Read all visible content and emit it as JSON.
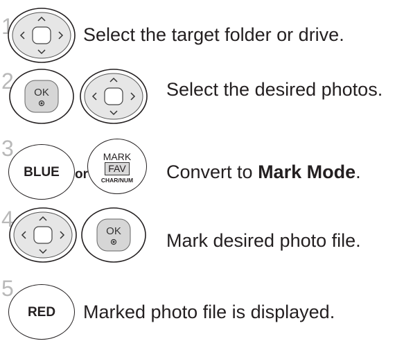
{
  "steps": [
    {
      "number": "1",
      "text": "Select the target folder or drive."
    },
    {
      "number": "2",
      "text": "Select the desired photos."
    },
    {
      "number": "3",
      "text_plain": "Convert to ",
      "text_bold": "Mark Mode",
      "text_end": "."
    },
    {
      "number": "4",
      "text": "Mark desired photo file."
    },
    {
      "number": "5",
      "text": "Marked photo file is displayed."
    }
  ],
  "buttons": {
    "ok_label": "OK",
    "blue_label": "BLUE",
    "or_label": "or",
    "mark_label": "MARK",
    "fav_label": "FAV",
    "charnum_label": "CHAR/NUM",
    "red_label": "RED"
  },
  "icons": {
    "nav_pad": "navigation-pad-icon",
    "ok_button": "ok-button-icon"
  }
}
